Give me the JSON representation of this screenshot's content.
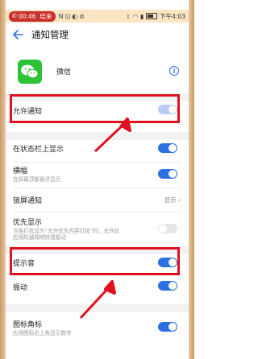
{
  "status_bar": {
    "call_time": "00:46",
    "call_label": "结束",
    "icons": [
      "N",
      "⊡",
      "◐",
      "⊘"
    ],
    "time": "下午4:03"
  },
  "header": {
    "title": "通知管理"
  },
  "app": {
    "name": "微信"
  },
  "rows": {
    "allow": {
      "label": "允许通知"
    },
    "statusbar": {
      "label": "在状态栏上显示"
    },
    "banner": {
      "label": "横幅",
      "sub": "在屏幕顶部悬浮显示"
    },
    "lockscreen": {
      "label": "锁屏通知",
      "value": "显示"
    },
    "priority": {
      "label": "优先显示",
      "sub1": "当免打扰设为“允许优先内容打扰”时，允许此",
      "sub2": "应用的通知响铃或振动"
    },
    "sound": {
      "label": "提示音"
    },
    "vibrate": {
      "label": "振动"
    },
    "badge": {
      "label": "图标角标",
      "sub": "应用图标右上角显示数字"
    }
  },
  "toggles": {
    "allow": "on",
    "statusbar": "on",
    "banner": "on",
    "priority": "off",
    "sound": "on",
    "vibrate": "on",
    "badge": "on"
  },
  "colors": {
    "accent": "#2b6fe4",
    "annotation_red": "#e0111f",
    "wechat_green": "#2ec235"
  }
}
